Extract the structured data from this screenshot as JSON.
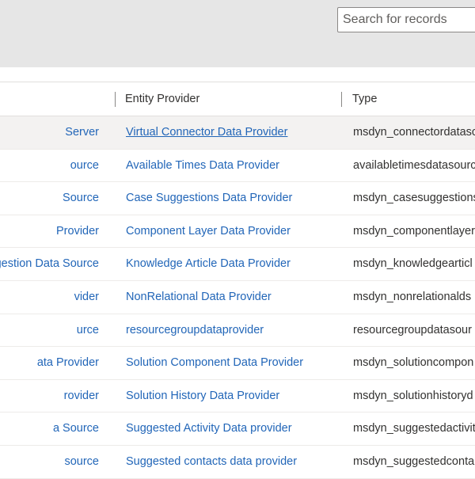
{
  "search": {
    "placeholder": "Search for records"
  },
  "table": {
    "headers": {
      "entity_provider": "Entity Provider",
      "type": "Type"
    },
    "rows": [
      {
        "name": "Server",
        "provider": "Virtual Connector Data Provider",
        "type": "msdyn_connectordatasc"
      },
      {
        "name": "ource",
        "provider": "Available Times Data Provider",
        "type": "availabletimesdatasourc"
      },
      {
        "name": "Source",
        "provider": "Case Suggestions Data Provider",
        "type": "msdyn_casesuggestions"
      },
      {
        "name": "Provider",
        "provider": "Component Layer Data Provider",
        "type": "msdyn_componentlayer"
      },
      {
        "name": "gestion Data Source",
        "provider": "Knowledge Article Data Provider",
        "type": "msdyn_knowledgearticl"
      },
      {
        "name": "vider",
        "provider": "NonRelational Data Provider",
        "type": "msdyn_nonrelationalds"
      },
      {
        "name": "urce",
        "provider": "resourcegroupdataprovider",
        "type": "resourcegroupdatasour"
      },
      {
        "name": "ata Provider",
        "provider": "Solution Component Data Provider",
        "type": "msdyn_solutioncompon"
      },
      {
        "name": "rovider",
        "provider": "Solution History Data Provider",
        "type": "msdyn_solutionhistoryd"
      },
      {
        "name": "a Source",
        "provider": "Suggested Activity Data provider",
        "type": "msdyn_suggestedactivit"
      },
      {
        "name": "source",
        "provider": "Suggested contacts data provider",
        "type": "msdyn_suggestedconta"
      }
    ]
  },
  "colors": {
    "link": "#2266b8",
    "text": "#323130",
    "topbar": "#e6e6e6",
    "selected_row": "#f3f2f1"
  }
}
